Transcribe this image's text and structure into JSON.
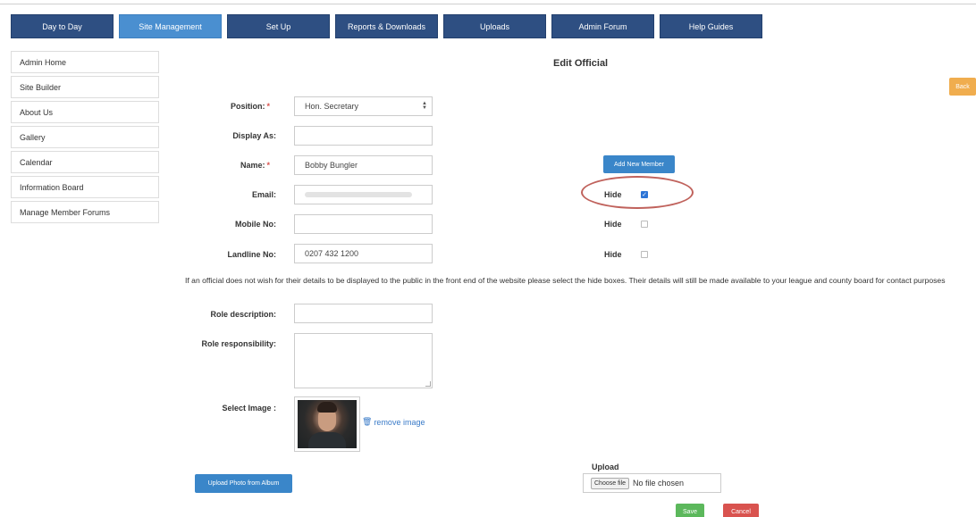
{
  "nav": {
    "items": [
      {
        "label": "Day to Day"
      },
      {
        "label": "Site Management"
      },
      {
        "label": "Set Up"
      },
      {
        "label": "Reports & Downloads"
      },
      {
        "label": "Uploads"
      },
      {
        "label": "Admin Forum"
      },
      {
        "label": "Help Guides"
      }
    ],
    "active": "Site Management",
    "colors": {
      "primary": "#2e4f82",
      "active": "#4a8fd0"
    }
  },
  "sidebar": {
    "items": [
      {
        "label": "Admin Home"
      },
      {
        "label": "Site Builder"
      },
      {
        "label": "About Us"
      },
      {
        "label": "Gallery"
      },
      {
        "label": "Calendar"
      },
      {
        "label": "Information Board"
      },
      {
        "label": "Manage Member Forums"
      }
    ]
  },
  "page": {
    "title": "Edit Official",
    "back_label": "Back"
  },
  "form": {
    "required_mark": "*",
    "position": {
      "label": "Position:",
      "value": "Hon. Secretary"
    },
    "display_as": {
      "label": "Display As:",
      "value": ""
    },
    "name": {
      "label": "Name:",
      "value": "Bobby Bungler"
    },
    "email": {
      "label": "Email:"
    },
    "mobile": {
      "label": "Mobile No:",
      "value": ""
    },
    "landline": {
      "label": "Landline No:",
      "value": "0207 432 1200"
    },
    "add_member_label": "Add New Member",
    "hide_label": "Hide",
    "hide_email_checked": true,
    "hide_mobile_checked": false,
    "hide_landline_checked": false,
    "privacy_note": "If an official does not wish for their details to be displayed to the public in the front end of the website please select the hide boxes. Their details will still be made available to your league and county board for contact purposes",
    "role_description": {
      "label": "Role description:",
      "value": ""
    },
    "role_responsibility": {
      "label": "Role responsibility:",
      "value": ""
    },
    "select_image": {
      "label": "Select Image :"
    },
    "remove_image_label": "remove image",
    "upload_album_label": "Upload Photo from Album",
    "upload_label": "Upload",
    "choose_file_label": "Choose file",
    "no_file_text": "No file chosen",
    "save_label": "Save",
    "cancel_label": "Cancel"
  }
}
